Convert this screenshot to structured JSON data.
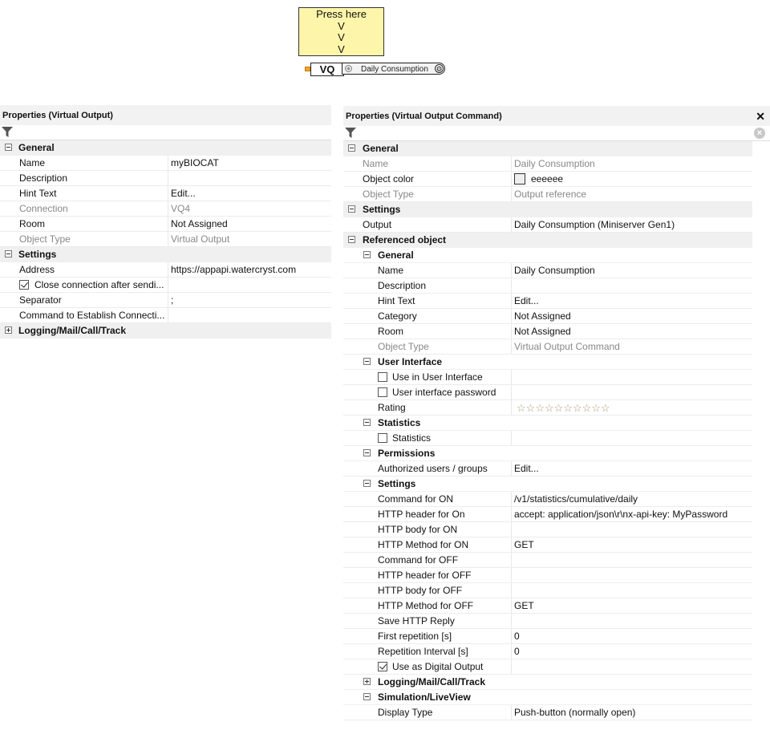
{
  "canvas": {
    "note_lines": [
      "Press here",
      "V",
      "V",
      "V"
    ],
    "block_name": "VQ",
    "block_command": "Daily Consumption"
  },
  "left_panel": {
    "title": "Properties (Virtual Output)",
    "rows": [
      {
        "type": "group",
        "label": "General",
        "expanded": true
      },
      {
        "label": "Name",
        "value": "myBIOCAT"
      },
      {
        "label": "Description",
        "value": ""
      },
      {
        "label": "Hint Text",
        "value": "Edit..."
      },
      {
        "label": "Connection",
        "value": "VQ4",
        "readonly": true
      },
      {
        "label": "Room",
        "value": "Not Assigned"
      },
      {
        "label": "Object Type",
        "value": "Virtual Output",
        "readonly": true
      },
      {
        "type": "group",
        "label": "Settings",
        "expanded": true
      },
      {
        "label": "Address",
        "value": "https://appapi.watercryst.com"
      },
      {
        "label": "Close connection after sendi...",
        "value": "",
        "checkbox": true,
        "checked": true
      },
      {
        "label": "Separator",
        "value": ";"
      },
      {
        "label": "Command to Establish Connecti...",
        "value": ""
      },
      {
        "type": "group",
        "label": "Logging/Mail/Call/Track",
        "expanded": false
      }
    ]
  },
  "right_panel": {
    "title": "Properties (Virtual Output Command)",
    "close_glyph": "✕",
    "object_color_hex": "#eeeeee",
    "rows": [
      {
        "type": "group",
        "label": "General",
        "expanded": true,
        "level": 0
      },
      {
        "label": "Name",
        "value": "Daily Consumption",
        "readonly": true,
        "level": 0
      },
      {
        "label": "Object color",
        "value": "eeeeee",
        "color_swatch": true,
        "level": 0
      },
      {
        "label": "Object Type",
        "value": "Output reference",
        "readonly": true,
        "level": 0
      },
      {
        "type": "group",
        "label": "Settings",
        "expanded": true,
        "level": 0
      },
      {
        "label": "Output",
        "value": "Daily Consumption (Miniserver Gen1)",
        "level": 0
      },
      {
        "type": "group",
        "label": "Referenced object",
        "expanded": true,
        "level": 0
      },
      {
        "type": "group",
        "label": "General",
        "expanded": true,
        "level": 1
      },
      {
        "label": "Name",
        "value": "Daily Consumption",
        "level": 1
      },
      {
        "label": "Description",
        "value": "",
        "level": 1
      },
      {
        "label": "Hint Text",
        "value": "Edit...",
        "level": 1
      },
      {
        "label": "Category",
        "value": "Not Assigned",
        "level": 1
      },
      {
        "label": "Room",
        "value": "Not Assigned",
        "level": 1
      },
      {
        "label": "Object Type",
        "value": "Virtual Output Command",
        "readonly": true,
        "level": 1
      },
      {
        "type": "group",
        "label": "User Interface",
        "expanded": true,
        "level": 1
      },
      {
        "label": "Use in User Interface",
        "value": "",
        "checkbox": true,
        "checked": false,
        "level": 1
      },
      {
        "label": "User interface password",
        "value": "",
        "checkbox": true,
        "checked": false,
        "level": 1
      },
      {
        "label": "Rating",
        "value": "",
        "stars": 10,
        "level": 1
      },
      {
        "type": "group",
        "label": "Statistics",
        "expanded": true,
        "level": 1
      },
      {
        "label": "Statistics",
        "value": "",
        "checkbox": true,
        "checked": false,
        "level": 1
      },
      {
        "type": "group",
        "label": "Permissions",
        "expanded": true,
        "level": 1
      },
      {
        "label": "Authorized users / groups",
        "value": "Edit...",
        "level": 1
      },
      {
        "type": "group",
        "label": "Settings",
        "expanded": true,
        "level": 1
      },
      {
        "label": "Command for ON",
        "value": "/v1/statistics/cumulative/daily",
        "level": 1
      },
      {
        "label": "HTTP header for On",
        "value": "accept: application/json\\r\\nx-api-key: MyPassword",
        "level": 1
      },
      {
        "label": "HTTP body for ON",
        "value": "",
        "level": 1
      },
      {
        "label": "HTTP Method for ON",
        "value": "GET",
        "level": 1
      },
      {
        "label": "Command for OFF",
        "value": "",
        "level": 1
      },
      {
        "label": "HTTP header for OFF",
        "value": "",
        "level": 1
      },
      {
        "label": "HTTP body for OFF",
        "value": "",
        "level": 1
      },
      {
        "label": "HTTP Method for OFF",
        "value": "GET",
        "level": 1
      },
      {
        "label": "Save HTTP Reply",
        "value": "",
        "level": 1
      },
      {
        "label": "First repetition [s]",
        "value": "0",
        "level": 1
      },
      {
        "label": "Repetition Interval [s]",
        "value": "0",
        "level": 1
      },
      {
        "label": "Use as Digital Output",
        "value": "",
        "checkbox": true,
        "checked": true,
        "level": 1
      },
      {
        "type": "group",
        "label": "Logging/Mail/Call/Track",
        "expanded": false,
        "level": 1
      },
      {
        "type": "group",
        "label": "Simulation/LiveView",
        "expanded": true,
        "level": 1
      },
      {
        "label": "Display Type",
        "value": "Push-button (normally open)",
        "level": 1
      }
    ]
  }
}
